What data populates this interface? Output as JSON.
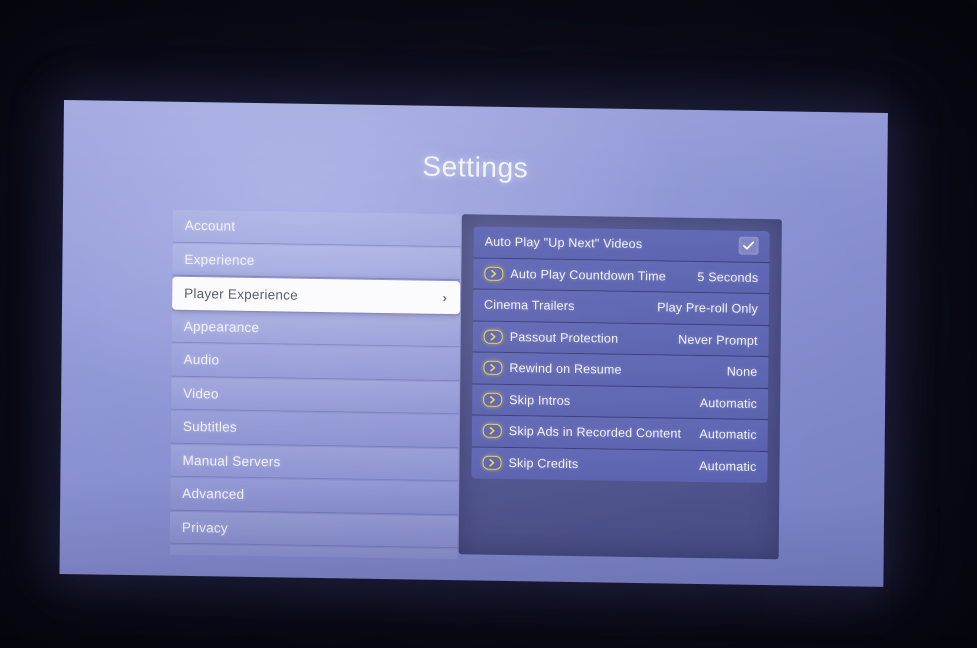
{
  "header": {
    "title": "Settings"
  },
  "sidebar": {
    "items": [
      {
        "label": "Account",
        "selected": false
      },
      {
        "label": "Experience",
        "selected": false
      },
      {
        "label": "Player Experience",
        "selected": true,
        "chevron": "›"
      },
      {
        "label": "Appearance",
        "selected": false
      },
      {
        "label": "Audio",
        "selected": false
      },
      {
        "label": "Video",
        "selected": false
      },
      {
        "label": "Subtitles",
        "selected": false
      },
      {
        "label": "Manual Servers",
        "selected": false
      },
      {
        "label": "Advanced",
        "selected": false
      },
      {
        "label": "Privacy",
        "selected": false
      },
      {
        "label": "",
        "selected": false
      }
    ]
  },
  "detail": {
    "rows": [
      {
        "label": "Auto Play \"Up Next\" Videos",
        "value": "",
        "badge": "none",
        "control": "checkbox",
        "checked": true
      },
      {
        "label": "Auto Play Countdown Time",
        "value": "5 Seconds",
        "badge": "plex-pass",
        "control": "value"
      },
      {
        "label": "Cinema Trailers",
        "value": "Play Pre-roll Only",
        "badge": "none",
        "control": "value"
      },
      {
        "label": "Passout Protection",
        "value": "Never Prompt",
        "badge": "plex-pass",
        "control": "value"
      },
      {
        "label": "Rewind on Resume",
        "value": "None",
        "badge": "plex-pass",
        "control": "value"
      },
      {
        "label": "Skip Intros",
        "value": "Automatic",
        "badge": "plex-pass",
        "control": "value"
      },
      {
        "label": "Skip Ads in Recorded Content",
        "value": "Automatic",
        "badge": "plex-pass",
        "control": "value"
      },
      {
        "label": "Skip Credits",
        "value": "Automatic",
        "badge": "plex-pass",
        "control": "value"
      }
    ]
  },
  "colors": {
    "screen_bg": "#8f96d6",
    "panel_bg": "#2e3264",
    "row_bg": "#5f66b4",
    "selected_row_bg": "#fbfbfd",
    "plex_pass_gold": "#e8d24a",
    "text_light": "#f1f2fb",
    "surround": "#07070f"
  }
}
